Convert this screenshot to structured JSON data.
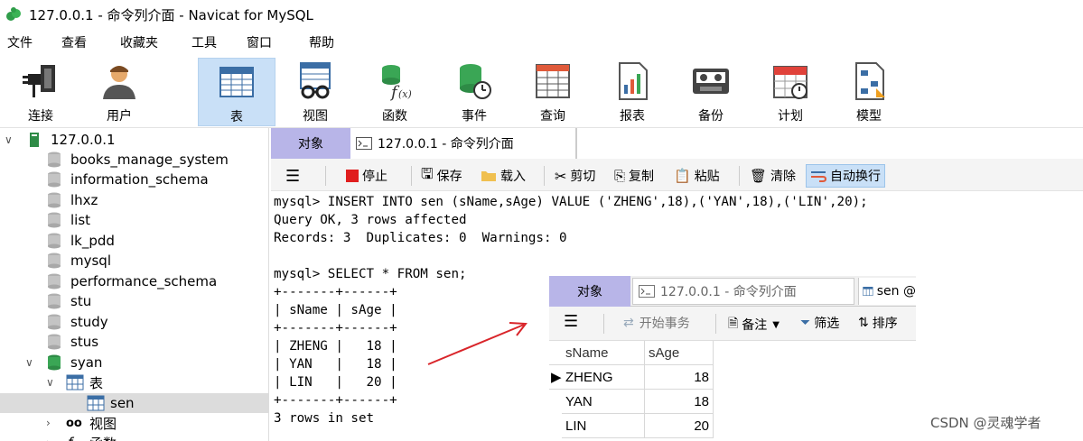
{
  "window": {
    "title": "127.0.0.1 - 命令列介面 - Navicat for MySQL"
  },
  "menu": [
    "文件",
    "查看",
    "收藏夹",
    "工具",
    "窗口",
    "帮助"
  ],
  "toolbar": {
    "items": [
      {
        "label": "连接",
        "icon": "plug-icon"
      },
      {
        "label": "用户",
        "icon": "user-icon"
      },
      {
        "label": "表",
        "icon": "table-icon",
        "active": true
      },
      {
        "label": "视图",
        "icon": "view-icon"
      },
      {
        "label": "函数",
        "icon": "function-icon"
      },
      {
        "label": "事件",
        "icon": "event-icon"
      },
      {
        "label": "查询",
        "icon": "query-icon"
      },
      {
        "label": "报表",
        "icon": "report-icon"
      },
      {
        "label": "备份",
        "icon": "backup-icon"
      },
      {
        "label": "计划",
        "icon": "schedule-icon"
      },
      {
        "label": "模型",
        "icon": "model-icon"
      }
    ]
  },
  "tree": {
    "connection": "127.0.0.1",
    "databases": [
      "books_manage_system",
      "information_schema",
      "lhxz",
      "list",
      "lk_pdd",
      "mysql",
      "performance_schema",
      "stu",
      "study",
      "stus"
    ],
    "open_database": "syan",
    "tables_node": "表",
    "selected_table": "sen",
    "views_node": "视图",
    "functions_node": "函数"
  },
  "tabs": {
    "objects": "对象",
    "console": "127.0.0.1 - 命令列介面"
  },
  "console_toolbar": {
    "stop": "停止",
    "save": "保存",
    "load": "载入",
    "cut": "剪切",
    "copy": "复制",
    "paste": "粘贴",
    "clear": "清除",
    "wrap": "自动换行"
  },
  "console_lines": [
    "mysql> INSERT INTO sen (sName,sAge) VALUE ('ZHENG',18),('YAN',18),('LIN',20);",
    "Query OK, 3 rows affected",
    "Records: 3  Duplicates: 0  Warnings: 0",
    "",
    "mysql> SELECT * FROM sen;",
    "+-------+------+",
    "| sName | sAge |",
    "+-------+------+",
    "| ZHENG |   18 |",
    "| YAN   |   18 |",
    "| LIN   |   20 |",
    "+-------+------+",
    "3 rows in set"
  ],
  "inset": {
    "tab_objects": "对象",
    "tab_console": "127.0.0.1 - 命令列介面",
    "tab_sen": "sen @",
    "begin_tx": "开始事务",
    "memo": "备注",
    "filter": "筛选",
    "sort": "排序",
    "columns": [
      "sName",
      "sAge"
    ],
    "rows": [
      {
        "sName": "ZHENG",
        "sAge": "18"
      },
      {
        "sName": "YAN",
        "sAge": "18"
      },
      {
        "sName": "LIN",
        "sAge": "20"
      }
    ]
  },
  "watermark": "CSDN @灵魂学者",
  "colors": {
    "tab_active": "#b8b5e8",
    "selected_tool": "#c9e0f7",
    "arrow": "#d9252a",
    "db_green": "#3aa655"
  }
}
